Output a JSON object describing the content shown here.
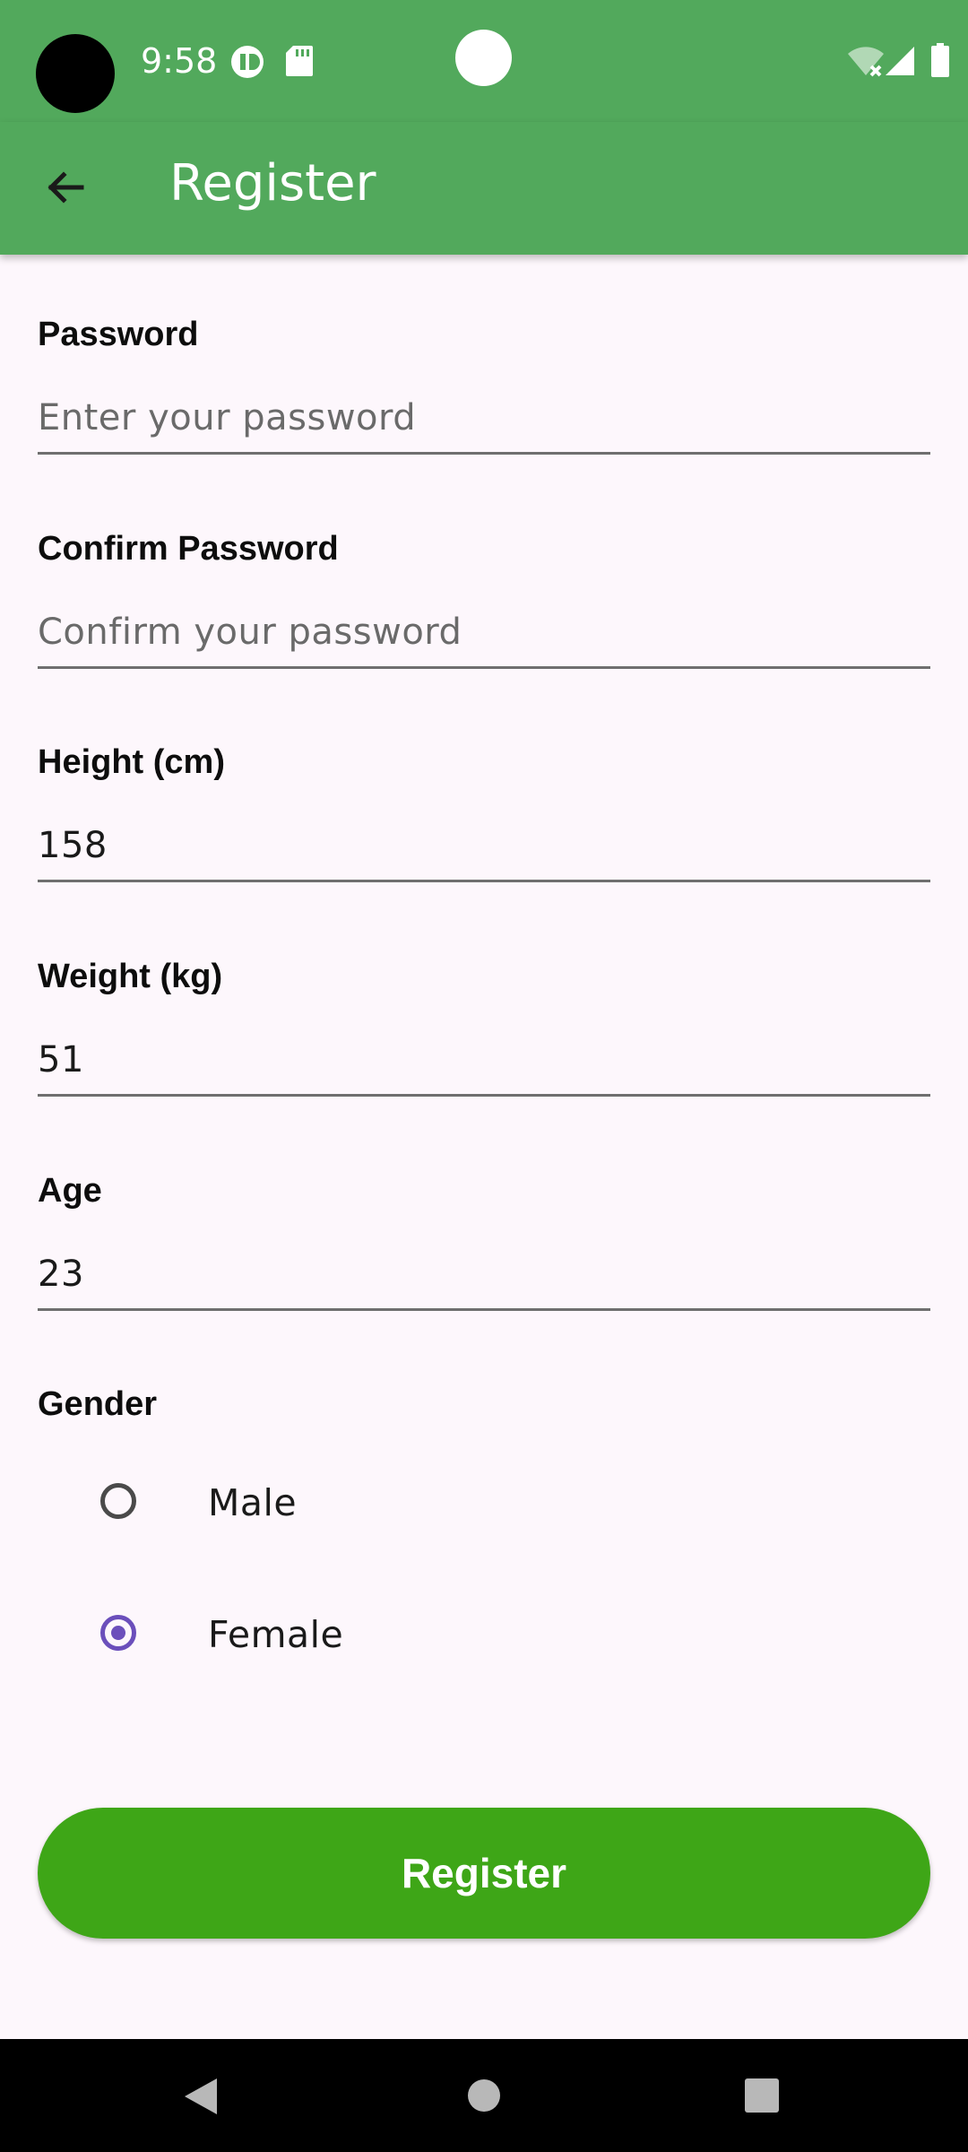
{
  "status_bar": {
    "time": "9:58",
    "icons": [
      "camera-cutout",
      "vpn-icon",
      "sd-card-icon",
      "wifi-off-icon",
      "signal-icon",
      "battery-icon"
    ]
  },
  "app_bar": {
    "title": "Register",
    "back_icon": "arrow-back-icon",
    "color": "#52a95c"
  },
  "form": {
    "password": {
      "label": "Password",
      "placeholder": "Enter your password",
      "value": ""
    },
    "confirm_password": {
      "label": "Confirm Password",
      "placeholder": "Confirm your password",
      "value": ""
    },
    "height": {
      "label": "Height (cm)",
      "placeholder": "",
      "value": "158"
    },
    "weight": {
      "label": "Weight (kg)",
      "placeholder": "",
      "value": "51"
    },
    "age": {
      "label": "Age",
      "placeholder": "",
      "value": "23"
    },
    "gender": {
      "label": "Gender",
      "options": [
        {
          "label": "Male",
          "selected": false
        },
        {
          "label": "Female",
          "selected": true
        }
      ],
      "accent": "#6b4fbb"
    }
  },
  "register_button": {
    "label": "Register",
    "color": "#3ea617"
  },
  "nav_bar": {
    "buttons": [
      "back-triangle-icon",
      "home-circle-icon",
      "recents-square-icon"
    ]
  }
}
